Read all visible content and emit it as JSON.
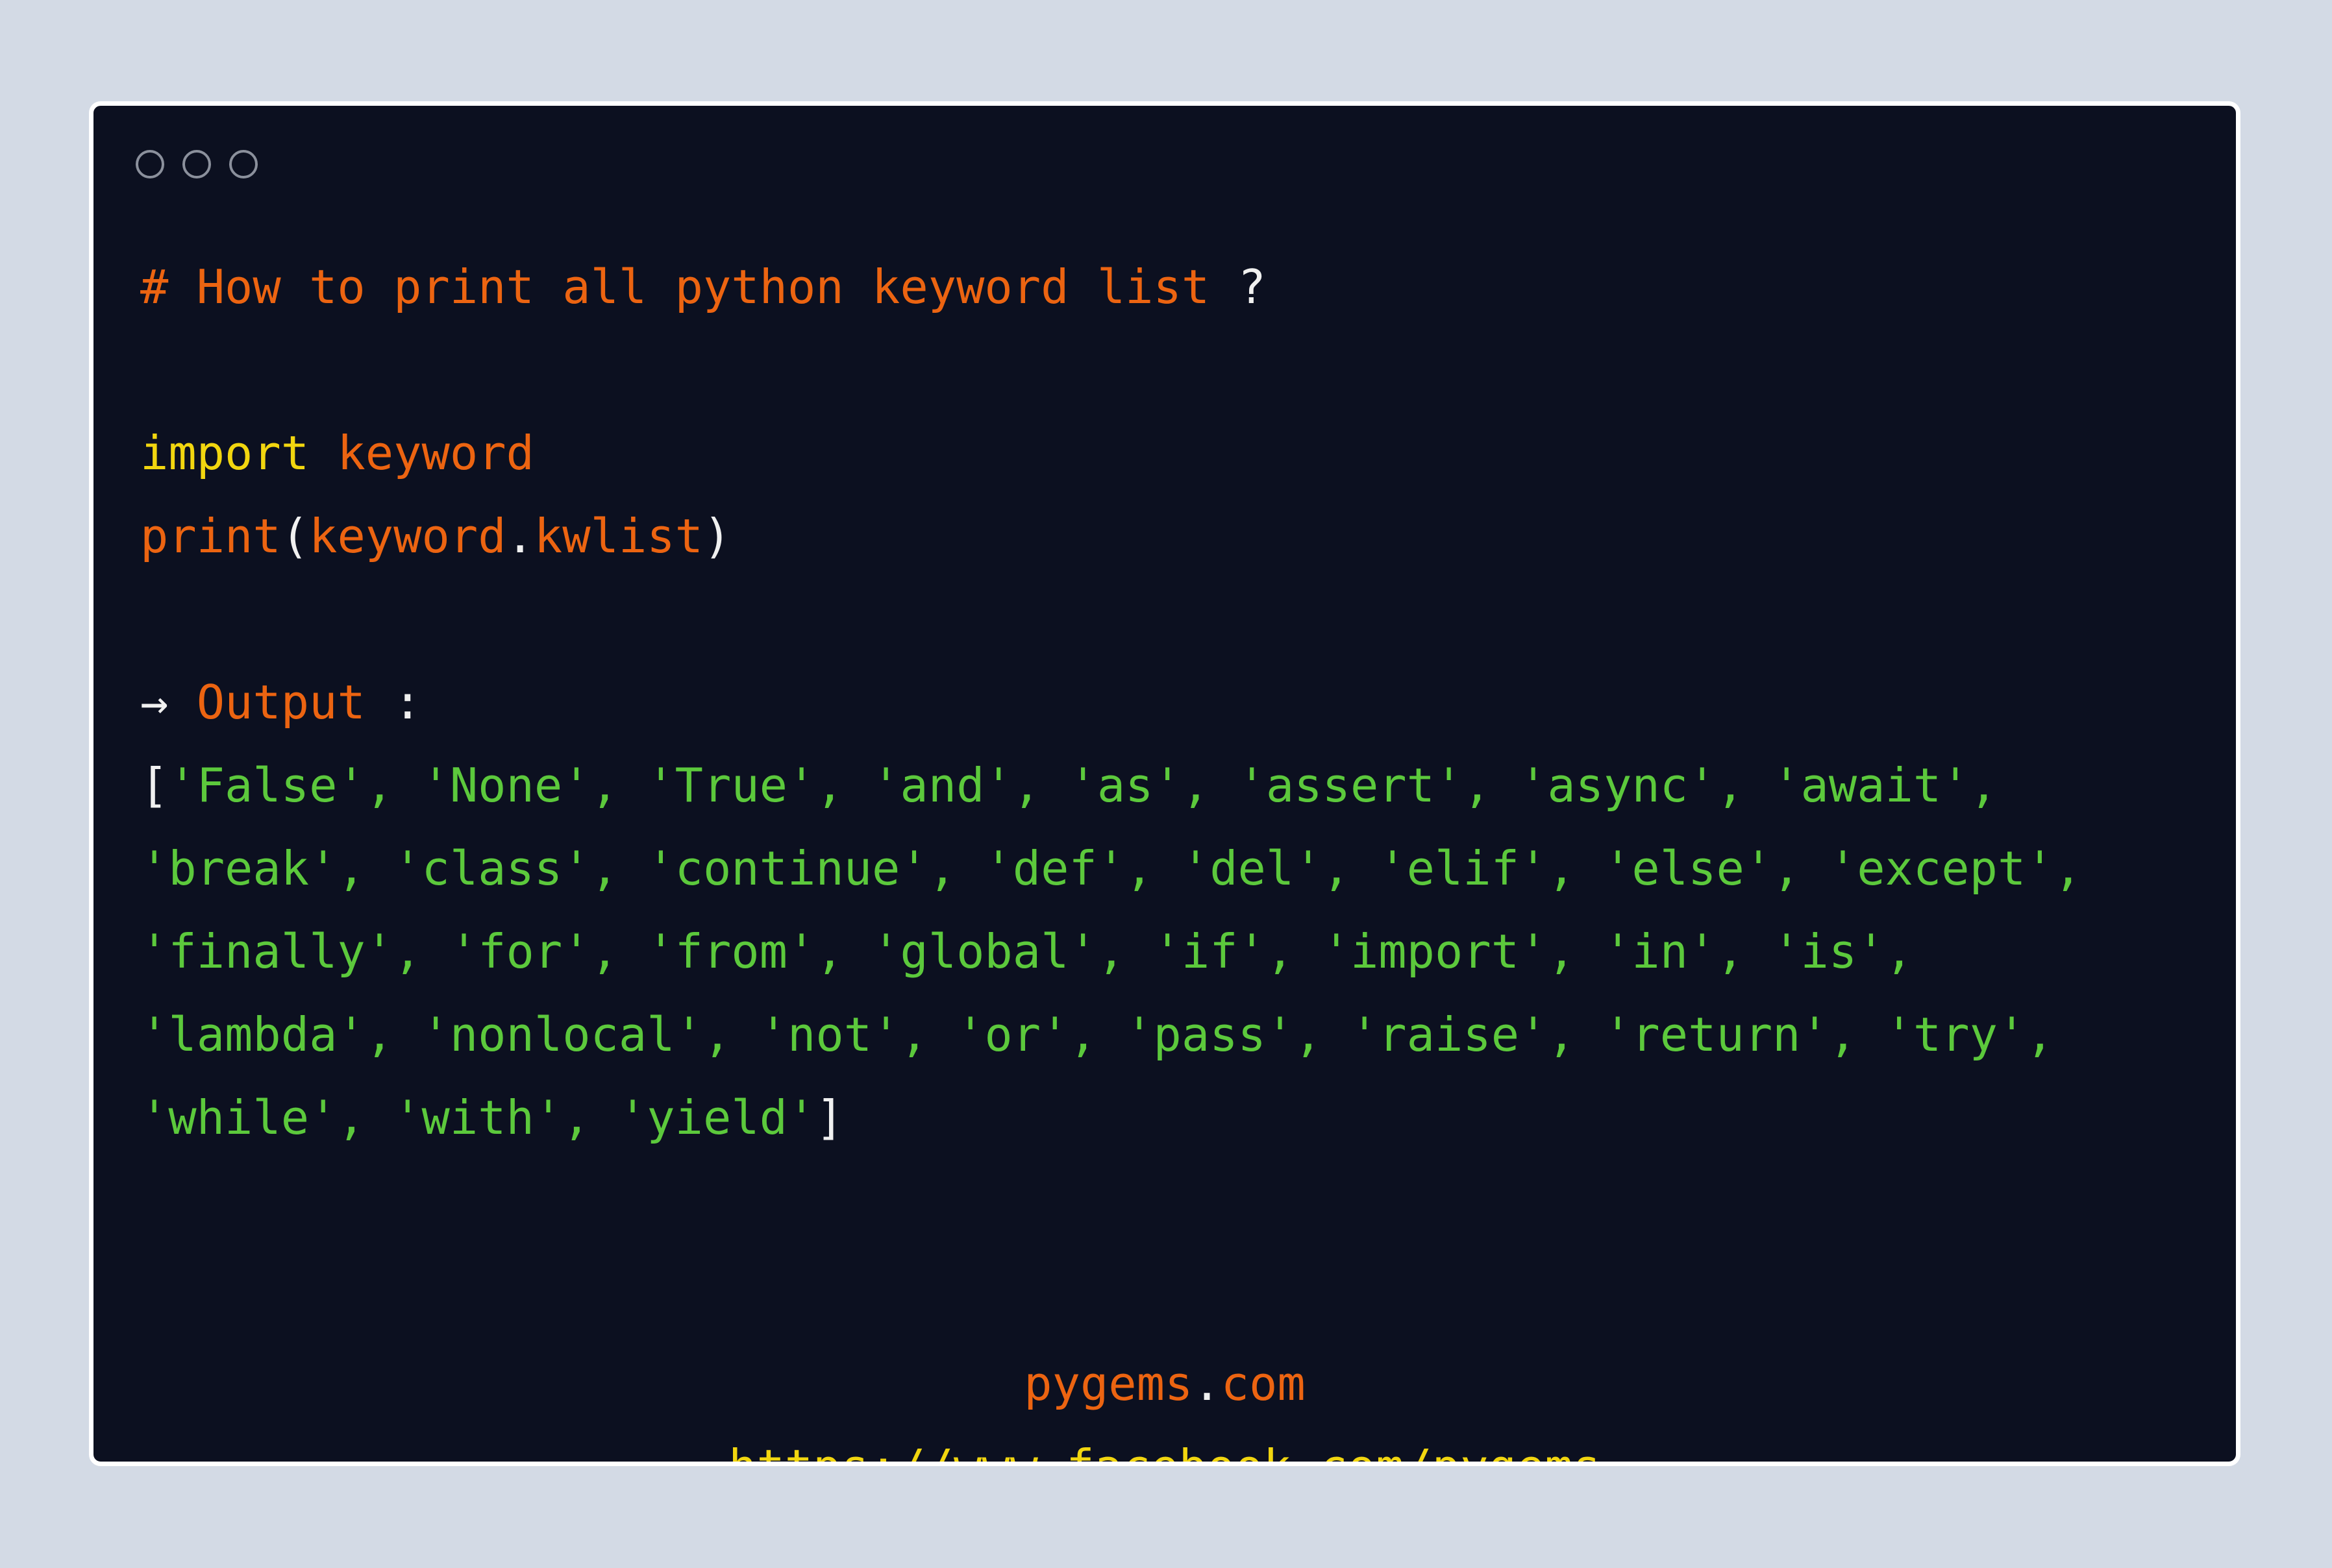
{
  "window": {
    "controls": [
      "window-dot",
      "window-dot",
      "window-dot"
    ]
  },
  "code": {
    "comment": "# How to print all python keyword list",
    "comment_mark": " ?",
    "import_kw": "import",
    "import_space": " ",
    "import_module": "keyword",
    "print_fn": "print",
    "paren_open": "(",
    "obj": "keyword",
    "dot": ".",
    "attr": "kwlist",
    "paren_close": ")",
    "arrow": "→",
    "arrow_space": " ",
    "output_label": "Output",
    "output_colon": " :",
    "list_open": "[",
    "list_close": "]",
    "output_lines": [
      "'False', 'None', 'True', 'and', 'as', 'assert', 'async', 'await',",
      "'break', 'class', 'continue', 'def', 'del', 'elif', 'else', 'except',",
      "'finally', 'for', 'from', 'global', 'if', 'import', 'in', 'is',",
      "'lambda', 'nonlocal', 'not', 'or', 'pass', 'raise', 'return', 'try',",
      "'while', 'with', 'yield'"
    ]
  },
  "footer": {
    "site_name": "pygems",
    "site_dot": ".",
    "site_tld": "com",
    "url": "https://www.facebook.com/pygems"
  },
  "colors": {
    "background": "#d3dae5",
    "editor_bg": "#0c1020",
    "orange": "#ec6411",
    "yellow": "#f2d60f",
    "green": "#5cc93c",
    "white": "#f0f0f0"
  }
}
